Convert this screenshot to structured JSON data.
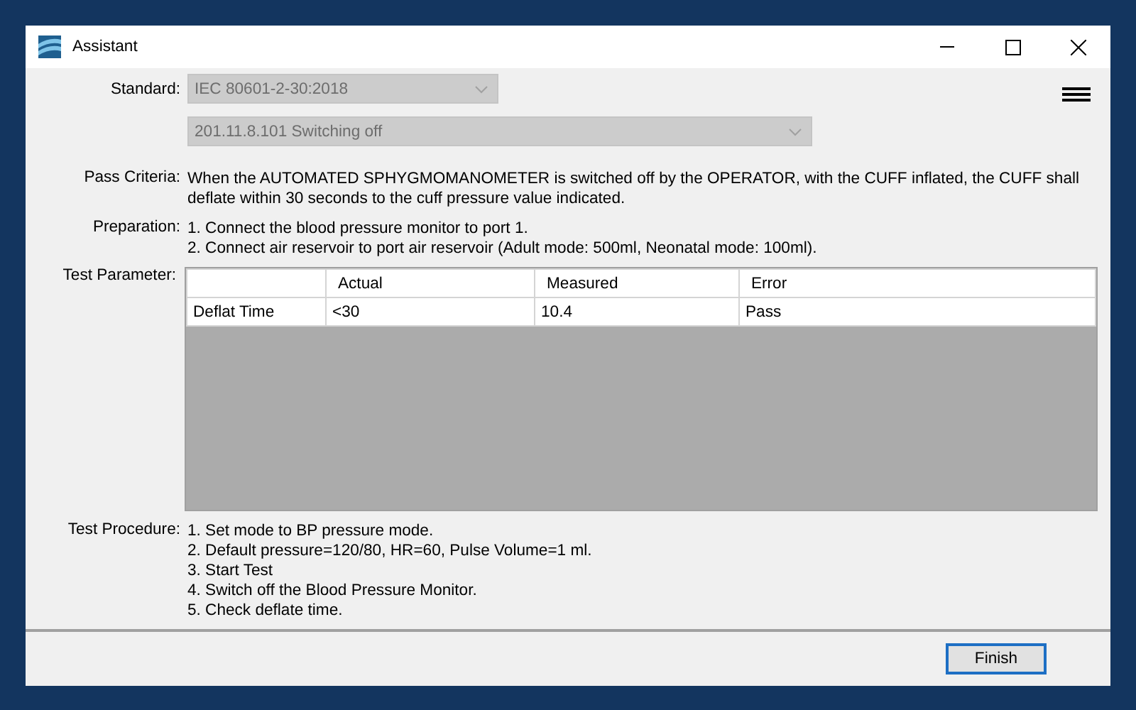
{
  "window": {
    "title": "Assistant"
  },
  "standard": {
    "label": "Standard:",
    "value": "IEC 80601-2-30:2018",
    "disabled": true
  },
  "clause": {
    "value": "201.11.8.101 Switching off",
    "disabled": true
  },
  "pass_criteria": {
    "label": "Pass Criteria:",
    "lines": [
      "When the AUTOMATED SPHYGMOMANOMETER is switched off by the OPERATOR, with the CUFF inflated, the CUFF shall",
      "deflate within 30 seconds to the cuff pressure value indicated."
    ]
  },
  "preparation": {
    "label": "Preparation:",
    "lines": [
      "1. Connect the blood pressure monitor to port 1.",
      "2. Connect air reservoir to port air reservoir (Adult mode: 500ml, Neonatal mode: 100ml)."
    ]
  },
  "test_parameter": {
    "label": "Test Parameter:",
    "table": {
      "columns": [
        "",
        "Actual",
        "Measured",
        "Error"
      ],
      "rows": [
        {
          "cells": [
            "Deflat Time",
            "<30",
            "10.4",
            "Pass"
          ]
        }
      ]
    }
  },
  "test_procedure": {
    "label": "Test Procedure:",
    "lines": [
      "1. Set mode to BP pressure mode.",
      "2. Default pressure=120/80, HR=60, Pulse Volume=1 ml.",
      "3. Start Test",
      "4. Switch off the Blood Pressure Monitor.",
      "5. Check deflate time."
    ]
  },
  "buttons": [
    {
      "label": "Finish"
    }
  ]
}
